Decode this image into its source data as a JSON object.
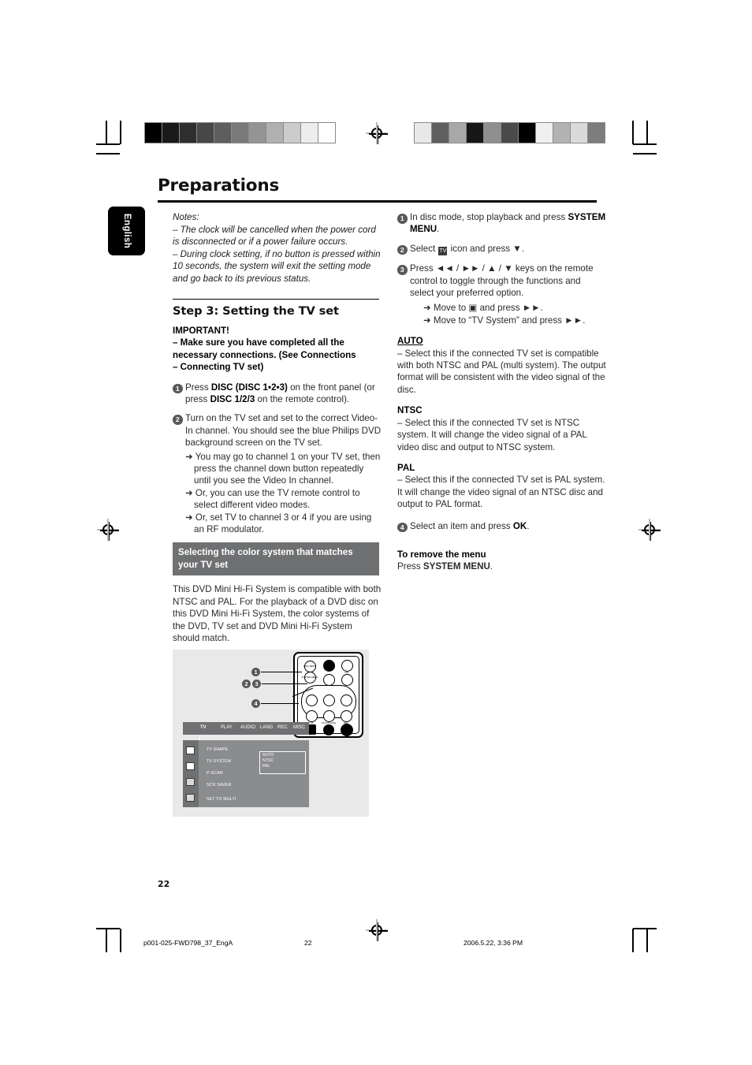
{
  "document": {
    "title": "Preparations",
    "language_tab": "English",
    "page_number": "22"
  },
  "left_column": {
    "notes": {
      "label": "Notes:",
      "items": [
        "–  The clock will be cancelled when the power cord is disconnected or if a power failure occurs.",
        "–  During clock setting, if no button is pressed within 10 seconds, the system will exit the setting mode and go back to its previous status."
      ]
    },
    "step_heading": "Step 3:  Setting the TV set",
    "important": {
      "heading": "IMPORTANT!",
      "lines": [
        "–   Make sure you have completed all the",
        "necessary connections. (See Connections",
        "– Connecting TV set)"
      ]
    },
    "steps": [
      {
        "number": "1",
        "parts": [
          {
            "t": "Press ",
            "b": false
          },
          {
            "t": "DISC (DISC 1•2•3)",
            "b": true
          },
          {
            "t": " on the front panel (or press ",
            "b": false
          },
          {
            "t": "DISC 1/2/3",
            "b": true
          },
          {
            "t": " on the remote control).",
            "b": false
          }
        ]
      },
      {
        "number": "2",
        "parts": [
          {
            "t": "Turn on the TV set and set to the correct Video-In channel. You should see the blue Philips DVD background screen on the TV set.",
            "b": false
          }
        ],
        "arrows": [
          "➜ You may go to channel 1 on your TV set, then press the channel down button repeatedly until you see the Video In channel.",
          "➜ Or, you can use the TV remote control to select different video modes.",
          "➜ Or, set TV to channel 3 or 4 if you are using an RF modulator."
        ]
      }
    ],
    "band_heading": "Selecting the color system that matches your TV set",
    "band_body": "This DVD Mini Hi-Fi System is compatible with both NTSC and PAL. For the playback of a DVD disc on this DVD Mini Hi-Fi System, the color systems of the DVD, TV set and DVD Mini Hi-Fi System should match."
  },
  "illustration": {
    "callouts": [
      "1",
      "2",
      "3",
      "4"
    ],
    "remote_labels": {
      "disc_menu": "DISC MENU",
      "system_menu": "SYSTEM MENU",
      "vol": "VOL",
      "stop": "STOP",
      "play_pause": "PLAY/PAUSE",
      "rec": "REC"
    },
    "osd_tabs": [
      "TV",
      "PLAY",
      "AUDIO",
      "LANG",
      "REC",
      "MISC"
    ],
    "menu_items": [
      "TV SHAPE",
      "TV SYSTEM",
      "P-SCAN",
      "SCR SAVER",
      "SET TO MULTI"
    ],
    "menu_options": [
      "AUTO",
      "NTSC",
      "PAL"
    ],
    "selected_option": "AUTO"
  },
  "right_column": {
    "steps": [
      {
        "number": "1",
        "parts": [
          {
            "t": "In disc mode, stop playback and press ",
            "b": false
          },
          {
            "t": "SYSTEM MENU",
            "b": true
          },
          {
            "t": ".",
            "b": false
          }
        ]
      },
      {
        "number": "2",
        "parts": [
          {
            "t": "Select ",
            "b": false
          },
          {
            "t": "[TV]",
            "b": false,
            "chip": true
          },
          {
            "t": " icon and press ▼.",
            "b": false
          }
        ]
      },
      {
        "number": "3",
        "parts": [
          {
            "t": "Press ◄◄ / ►► / ▲ / ▼ keys on the remote control to toggle through the functions and select your preferred option.",
            "b": false
          }
        ],
        "arrows": [
          "➜ Move to  ▣  and press ►►.",
          "➜ Move to “TV System” and press ►►."
        ]
      },
      {
        "number": "4",
        "parts": [
          {
            "t": "Select an item and press ",
            "b": false
          },
          {
            "t": "OK",
            "b": true
          },
          {
            "t": ".",
            "b": false
          }
        ]
      }
    ],
    "options": [
      {
        "name": "AUTO",
        "underline": true,
        "body": "–   Select this if the connected TV set is compatible with both NTSC and PAL (multi system). The output format will be consistent with the video signal of the disc."
      },
      {
        "name": "NTSC",
        "underline": false,
        "body": "–   Select this if the connected TV set is NTSC system. It will change the video signal of a PAL video disc and output to NTSC system."
      },
      {
        "name": "PAL",
        "underline": false,
        "body": "–   Select this if the connected TV set is PAL system. It will change the video signal of an NTSC disc and output to PAL format."
      }
    ],
    "remove_menu": {
      "heading": "To remove the menu",
      "parts": [
        {
          "t": "Press ",
          "b": false
        },
        {
          "t": "SYSTEM MENU",
          "b": true
        },
        {
          "t": ".",
          "b": false
        }
      ]
    }
  },
  "footer": {
    "file_name": "p001-025-FWD798_37_EngA",
    "page": "22",
    "timestamp": "2006.5.22, 3:36 PM"
  },
  "colors": {
    "band": "#6f7072",
    "bullet": "#58595b",
    "text": "#2a2a2a"
  },
  "grayscale_bar_left": [
    "#000000",
    "#1a1a1a",
    "#2e2e2e",
    "#474747",
    "#5e5e5e",
    "#7a7a7a",
    "#949494",
    "#b0b0b0",
    "#cccccc",
    "#ededed",
    "#ffffff"
  ],
  "grayscale_bar_right": [
    "#e8e8e8",
    "#5f5f5f",
    "#a8a8a8",
    "#161616",
    "#8f8f8f",
    "#4a4a4a",
    "#000000",
    "#f0f0f0",
    "#b3b3b3",
    "#dadada",
    "#7d7d7d"
  ]
}
